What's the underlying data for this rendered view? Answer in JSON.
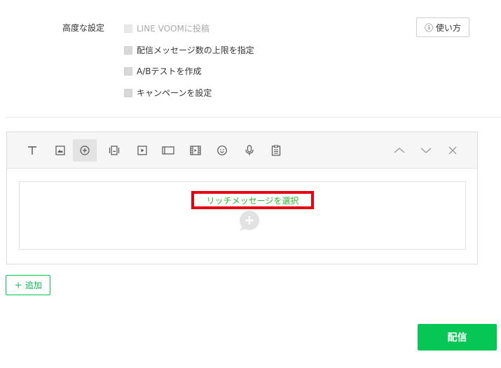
{
  "settings": {
    "label": "高度な設定",
    "options": [
      {
        "label": "LINE VOOMに投稿",
        "disabled": true
      },
      {
        "label": "配信メッセージ数の上限を指定",
        "disabled": false
      },
      {
        "label": "A/Bテストを作成",
        "disabled": false
      },
      {
        "label": "キャンペーンを設定",
        "disabled": false
      }
    ],
    "help_label": "ⓘ 使い方"
  },
  "editor": {
    "tools": [
      "text-icon",
      "image-icon",
      "rich-message-icon",
      "card-icon",
      "video-icon",
      "rich-video-icon",
      "movie-icon",
      "sticker-icon",
      "voice-icon",
      "survey-icon"
    ],
    "active_tool": "rich-message-icon",
    "rich_select_label": "リッチメッセージを選択"
  },
  "actions": {
    "add_label": "＋ 追加",
    "send_label": "配信"
  },
  "colors": {
    "accent_green": "#06c755",
    "highlight_red": "#e60012"
  }
}
